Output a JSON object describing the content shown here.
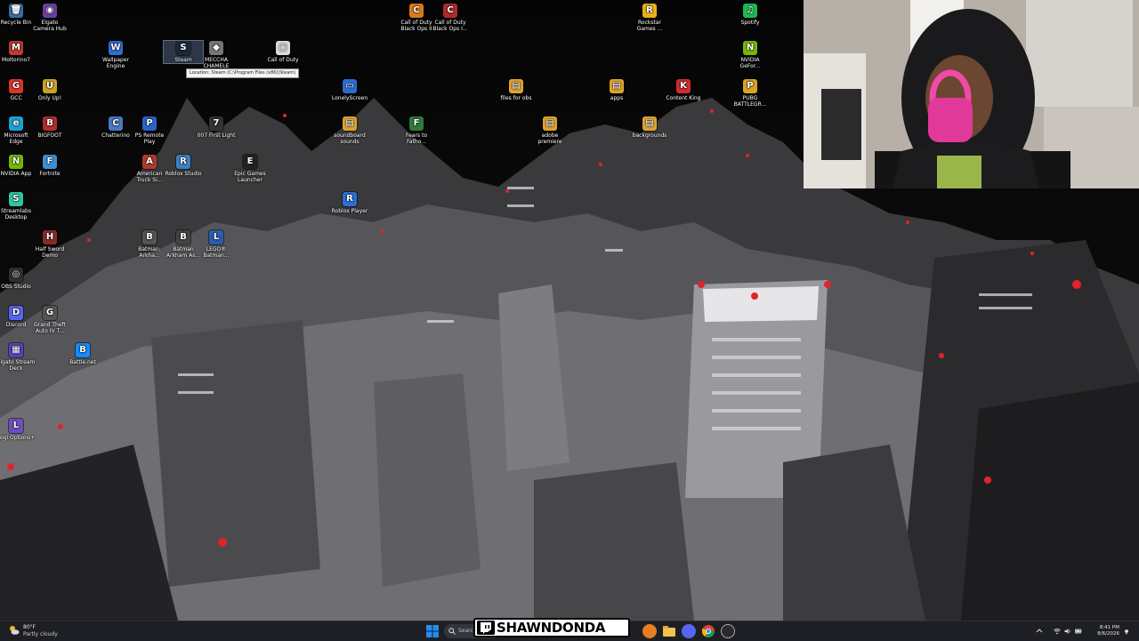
{
  "desktop": {
    "icons": [
      {
        "label": "Recycle Bin",
        "glyph": "🗑",
        "color": "#3a6ea5"
      },
      {
        "label": "Elgato Camera Hub",
        "glyph": "◉",
        "color": "#6b3fa0"
      },
      {
        "label": "Moltorino7",
        "glyph": "M",
        "color": "#c0392b"
      },
      {
        "label": "Wallpaper Engine",
        "glyph": "W",
        "color": "#2d6fd6"
      },
      {
        "label": "Steam",
        "glyph": "S",
        "color": "#1b2838"
      },
      {
        "label": "MECCHA CHAMELE",
        "glyph": "◆",
        "color": "#777777"
      },
      {
        "label": "Call of Duty",
        "glyph": "▢",
        "color": "#dddddd"
      },
      {
        "label": "Call of Duty Black Ops II",
        "glyph": "C",
        "color": "#d97a1c"
      },
      {
        "label": "Call of Duty Black Ops I...",
        "glyph": "C",
        "color": "#b02a2a"
      },
      {
        "label": "Rockstar Games ...",
        "glyph": "R",
        "color": "#e8b21a"
      },
      {
        "label": "Spotify",
        "glyph": "♫",
        "color": "#1db954"
      },
      {
        "label": "NVIDIA GeFor...",
        "glyph": "N",
        "color": "#76b900"
      },
      {
        "label": "GCC",
        "glyph": "G",
        "color": "#d9342b"
      },
      {
        "label": "Only Up!",
        "glyph": "U",
        "color": "#c9a227"
      },
      {
        "label": "LonelyScreen",
        "glyph": "▭",
        "color": "#2b6cd1"
      },
      {
        "label": "files for obs",
        "glyph": "▤",
        "color": "#e2a42c"
      },
      {
        "label": "apps",
        "glyph": "▤",
        "color": "#e2a42c"
      },
      {
        "label": "Content King",
        "glyph": "K",
        "color": "#d22c2c"
      },
      {
        "label": "PUBG BATTLEGR...",
        "glyph": "P",
        "color": "#d9a323"
      },
      {
        "label": "Microsoft Edge",
        "glyph": "e",
        "color": "#1e9fd6"
      },
      {
        "label": "BIGFOOT",
        "glyph": "B",
        "color": "#b32d2d"
      },
      {
        "label": "Chatterino",
        "glyph": "C",
        "color": "#4a78c2"
      },
      {
        "label": "PS Remote Play",
        "glyph": "P",
        "color": "#2b63c9"
      },
      {
        "label": "007 First Light",
        "glyph": "7",
        "color": "#333333"
      },
      {
        "label": "soundboard sounds",
        "glyph": "▤",
        "color": "#e2a42c"
      },
      {
        "label": "Fears to Fatho...",
        "glyph": "F",
        "color": "#2f7a3a"
      },
      {
        "label": "adobe premiere",
        "glyph": "▤",
        "color": "#e2a42c"
      },
      {
        "label": "backgrounds",
        "glyph": "▤",
        "color": "#e2a42c"
      },
      {
        "label": "NVIDIA App",
        "glyph": "N",
        "color": "#76b900"
      },
      {
        "label": "Fortnite",
        "glyph": "F",
        "color": "#3a8fd6"
      },
      {
        "label": "American Truck Si...",
        "glyph": "A",
        "color": "#b03a2e"
      },
      {
        "label": "Roblox Studio",
        "glyph": "R",
        "color": "#3b82c4"
      },
      {
        "label": "Epic Games Launcher",
        "glyph": "E",
        "color": "#222222"
      },
      {
        "label": "Roblox Player",
        "glyph": "R",
        "color": "#2c6fd6"
      },
      {
        "label": "Streamlabs Desktop",
        "glyph": "S",
        "color": "#31c3a2"
      },
      {
        "label": "Half Sword Demo",
        "glyph": "H",
        "color": "#8a2b2b"
      },
      {
        "label": "Batman: Arkha...",
        "glyph": "B",
        "color": "#555555"
      },
      {
        "label": "Batman Arkham As...",
        "glyph": "B",
        "color": "#444444"
      },
      {
        "label": "LEGO® Batman...",
        "glyph": "L",
        "color": "#2a5db0"
      },
      {
        "label": "OBS Studio",
        "glyph": "◎",
        "color": "#302e31"
      },
      {
        "label": "Discord",
        "glyph": "D",
        "color": "#5865f2"
      },
      {
        "label": "Grand Theft Auto IV T...",
        "glyph": "G",
        "color": "#555555"
      },
      {
        "label": "Elgato Stream Deck",
        "glyph": "▦",
        "color": "#5a3fc0"
      },
      {
        "label": "Battle.net",
        "glyph": "B",
        "color": "#148eff"
      },
      {
        "label": "Logi Options+",
        "glyph": "L",
        "color": "#6a4fc2"
      }
    ],
    "tooltip": "Location: Steam (C:\\Program Files (x86)\\Steam)"
  },
  "taskbar": {
    "weather_temp": "80°F",
    "weather_condition": "Partly cloudy",
    "search_placeholder": "Search",
    "streamer_name": "SHAWNDONDA",
    "time": "8:41 PM",
    "date": "8/6/2026"
  },
  "colors": {
    "taskbar_bg": "#1d1f24",
    "wallpaper_red": "#e0242a",
    "windows_blue": "#1f8ff0"
  }
}
